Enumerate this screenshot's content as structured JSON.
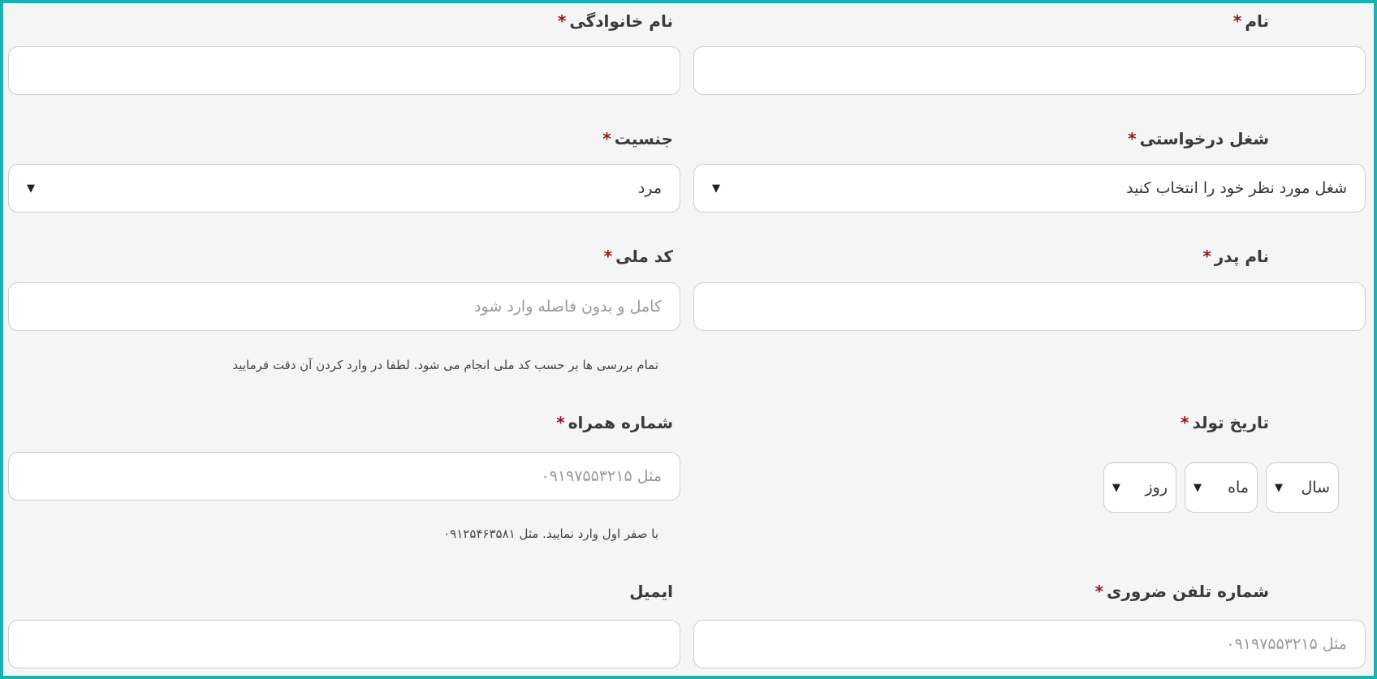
{
  "required_mark": "*",
  "fields": {
    "first_name": {
      "label": "نام",
      "value": ""
    },
    "last_name": {
      "label": "نام خانوادگی",
      "value": ""
    },
    "job": {
      "label": "شغل درخواستی",
      "selected": "شغل مورد نظر خود را انتخاب کنید"
    },
    "gender": {
      "label": "جنسیت",
      "selected": "مرد"
    },
    "father_name": {
      "label": "نام پدر",
      "value": ""
    },
    "national_code": {
      "label": "کد ملی",
      "placeholder": "کامل و بدون فاصله وارد شود",
      "hint": "تمام بررسی ها بر حسب کد ملی انجام می شود. لطفا در وارد کردن آن دقت فرمایید"
    },
    "birth_date": {
      "label": "تاریخ تولد",
      "year": "سال",
      "month": "ماه",
      "day": "روز"
    },
    "mobile": {
      "label": "شماره همراه",
      "placeholder": "مثل ۰۹۱۹۷۵۵۳۲۱۵",
      "hint": "با صفر اول وارد نمایید. مثل ۰۹۱۲۵۴۶۳۵۸۱"
    },
    "emergency_phone": {
      "label": "شماره تلفن ضروری",
      "placeholder": "مثل ۰۹۱۹۷۵۵۳۲۱۵"
    },
    "email": {
      "label": "ایمیل",
      "value": ""
    }
  },
  "icons": {
    "dropdown": "chevron-down-icon"
  },
  "colors": {
    "border_accent": "#18b3b0",
    "required": "#8b1a1a"
  }
}
